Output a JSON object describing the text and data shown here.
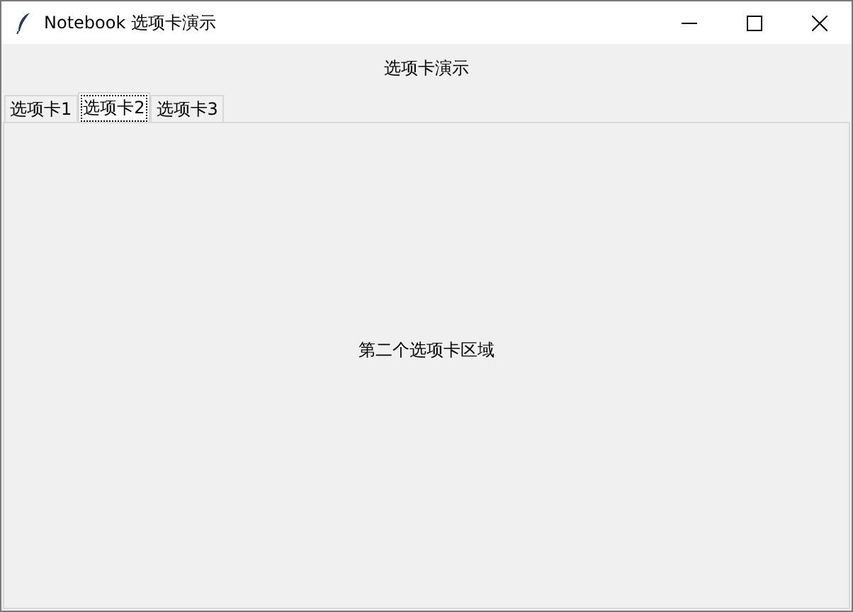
{
  "window": {
    "title": "Notebook 选项卡演示"
  },
  "heading": "选项卡演示",
  "tabs": [
    {
      "label": "选项卡1",
      "selected": false
    },
    {
      "label": "选项卡2",
      "selected": true
    },
    {
      "label": "选项卡3",
      "selected": false
    }
  ],
  "panel": {
    "text": "第二个选项卡区域"
  }
}
